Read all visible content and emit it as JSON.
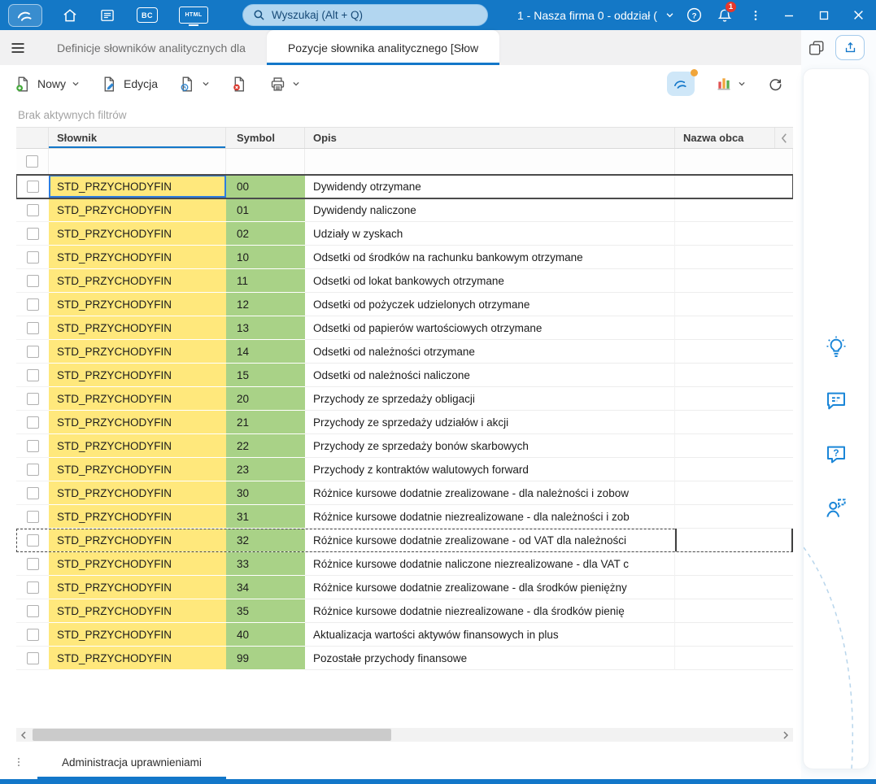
{
  "colors": {
    "accent": "#1377c9",
    "titlebar_bg": "#1478c6",
    "search_bg": "#b2d6f0",
    "cell_yellow": "#ffe87c",
    "cell_green": "#a9d287",
    "focus_blue": "#2d7de0",
    "badge_red": "#e6382c",
    "icon_blue": "#1a86d8"
  },
  "titlebar": {
    "search_placeholder": "Wyszukaj (Alt + Q)",
    "company_label": "1 - Nasza firma 0 - oddział (",
    "notification_count": "1",
    "bc_label": "BC",
    "html_label": "HTML"
  },
  "tabs": {
    "inactive_label": "Definicje słowników analitycznych dla",
    "active_label": "Pozycje słownika analitycznego [Słow"
  },
  "toolbar": {
    "new_label": "Nowy",
    "edit_label": "Edycja"
  },
  "filter_status": "Brak aktywnych filtrów",
  "table": {
    "columns": [
      "Słownik",
      "Symbol",
      "Opis",
      "Nazwa obca"
    ],
    "rows": [
      {
        "slownik": "STD_PRZYCHODYFIN",
        "symbol": "00",
        "opis": "Dywidendy otrzymane",
        "nazwa_obca": "",
        "state": "focused"
      },
      {
        "slownik": "STD_PRZYCHODYFIN",
        "symbol": "01",
        "opis": "Dywidendy naliczone",
        "nazwa_obca": ""
      },
      {
        "slownik": "STD_PRZYCHODYFIN",
        "symbol": "02",
        "opis": "Udziały w zyskach",
        "nazwa_obca": ""
      },
      {
        "slownik": "STD_PRZYCHODYFIN",
        "symbol": "10",
        "opis": "Odsetki od środków na rachunku bankowym  otrzymane",
        "nazwa_obca": ""
      },
      {
        "slownik": "STD_PRZYCHODYFIN",
        "symbol": "11",
        "opis": "Odsetki od lokat bankowych  otrzymane",
        "nazwa_obca": ""
      },
      {
        "slownik": "STD_PRZYCHODYFIN",
        "symbol": "12",
        "opis": "Odsetki od pożyczek udzielonych  otrzymane",
        "nazwa_obca": ""
      },
      {
        "slownik": "STD_PRZYCHODYFIN",
        "symbol": "13",
        "opis": "Odsetki od papierów wartościowych  otrzymane",
        "nazwa_obca": ""
      },
      {
        "slownik": "STD_PRZYCHODYFIN",
        "symbol": "14",
        "opis": "Odsetki od należności otrzymane",
        "nazwa_obca": ""
      },
      {
        "slownik": "STD_PRZYCHODYFIN",
        "symbol": "15",
        "opis": "Odsetki od należności naliczone",
        "nazwa_obca": ""
      },
      {
        "slownik": "STD_PRZYCHODYFIN",
        "symbol": "20",
        "opis": "Przychody ze sprzedaży obligacji",
        "nazwa_obca": ""
      },
      {
        "slownik": "STD_PRZYCHODYFIN",
        "symbol": "21",
        "opis": "Przychody ze sprzedaży udziałów i akcji",
        "nazwa_obca": ""
      },
      {
        "slownik": "STD_PRZYCHODYFIN",
        "symbol": "22",
        "opis": "Przychody ze sprzedaży bonów skarbowych",
        "nazwa_obca": ""
      },
      {
        "slownik": "STD_PRZYCHODYFIN",
        "symbol": "23",
        "opis": "Przychody z kontraktów walutowych forward",
        "nazwa_obca": ""
      },
      {
        "slownik": "STD_PRZYCHODYFIN",
        "symbol": "30",
        "opis": "Różnice kursowe dodatnie zrealizowane -  dla należności i zobow",
        "nazwa_obca": ""
      },
      {
        "slownik": "STD_PRZYCHODYFIN",
        "symbol": "31",
        "opis": "Różnice kursowe dodatnie niezrealizowane -  dla należności i zob",
        "nazwa_obca": ""
      },
      {
        "slownik": "STD_PRZYCHODYFIN",
        "symbol": "32",
        "opis": "Różnice kursowe dodatnie zrealizowane -  od VAT dla należności",
        "nazwa_obca": "",
        "state": "dashed",
        "editing_nazwa": true
      },
      {
        "slownik": "STD_PRZYCHODYFIN",
        "symbol": "33",
        "opis": "Różnice kursowe dodatnie naliczone niezrealizowane -  dla VAT c",
        "nazwa_obca": ""
      },
      {
        "slownik": "STD_PRZYCHODYFIN",
        "symbol": "34",
        "opis": "Różnice kursowe dodatnie zrealizowane -  dla środków pieniężny",
        "nazwa_obca": ""
      },
      {
        "slownik": "STD_PRZYCHODYFIN",
        "symbol": "35",
        "opis": "Różnice kursowe dodatnie niezrealizowane -  dla środków pienię",
        "nazwa_obca": ""
      },
      {
        "slownik": "STD_PRZYCHODYFIN",
        "symbol": "40",
        "opis": "Aktualizacja wartości aktywów finansowych in plus",
        "nazwa_obca": ""
      },
      {
        "slownik": "STD_PRZYCHODYFIN",
        "symbol": "99",
        "opis": "Pozostałe przychody finansowe",
        "nazwa_obca": ""
      }
    ]
  },
  "bottom_tab_label": "Administracja uprawnieniami"
}
